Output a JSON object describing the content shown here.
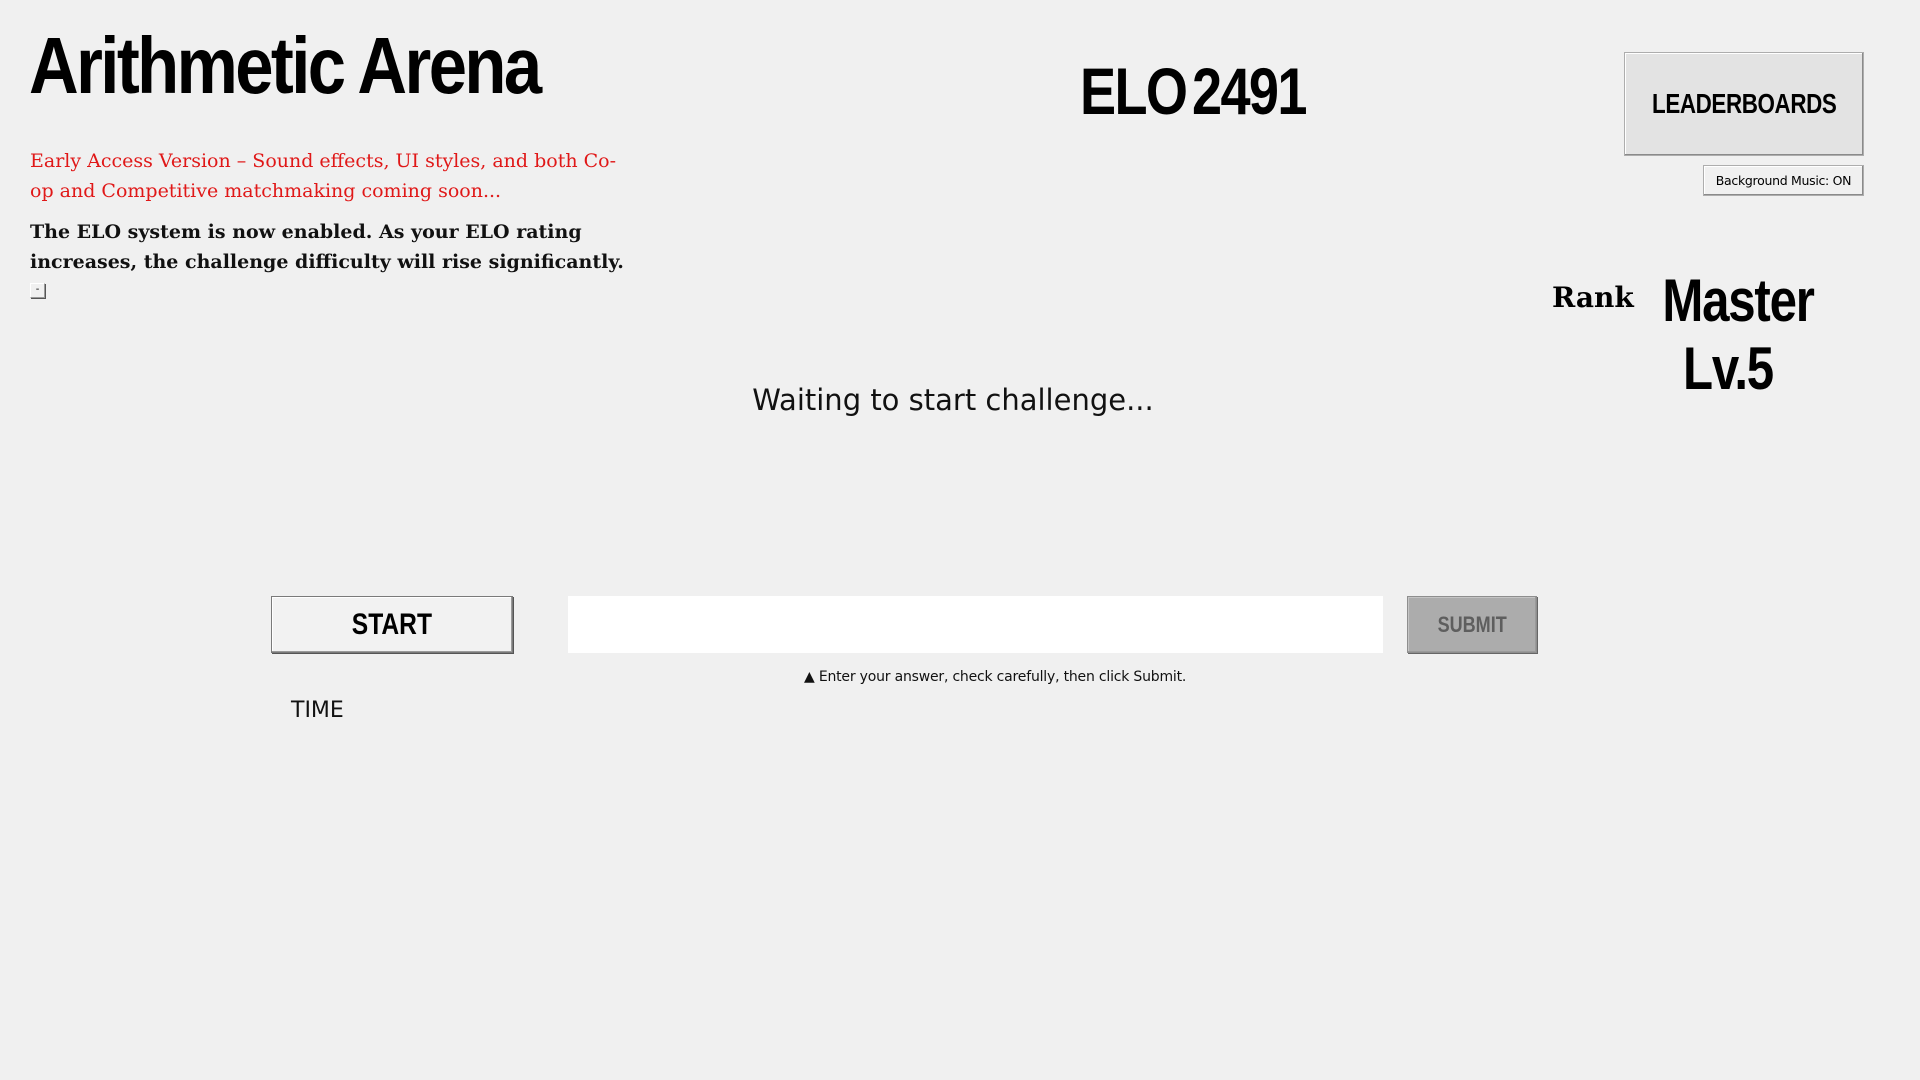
{
  "header": {
    "title": "Arithmetic Arena",
    "notice_early_access": "Early Access Version – Sound effects, UI styles, and both Co-op and Competitive matchmaking coming soon...",
    "notice_elo": "The ELO system is now enabled. As your ELO rating increases, the challenge difficulty will rise significantly.",
    "collapse_label": "-"
  },
  "elo": {
    "label": "ELO",
    "value": "2491"
  },
  "controls_top": {
    "leaderboards_label": "LEADERBOARDS",
    "music_label": "Background Music: ON"
  },
  "rank": {
    "label": "Rank",
    "name_line1": "Master",
    "name_line2": "Lv.5"
  },
  "challenge": {
    "status": "Waiting to start challenge...",
    "start_label": "START",
    "answer_value": "",
    "submit_label": "SUBMIT",
    "hint": "▲ Enter your answer, check carefully, then click Submit.",
    "time_label": "TIME"
  },
  "colors": {
    "background": "#f0f0f0",
    "notice_red": "#e01818",
    "submit_disabled_bg": "#acacac",
    "submit_disabled_text": "#5e5e5e"
  }
}
